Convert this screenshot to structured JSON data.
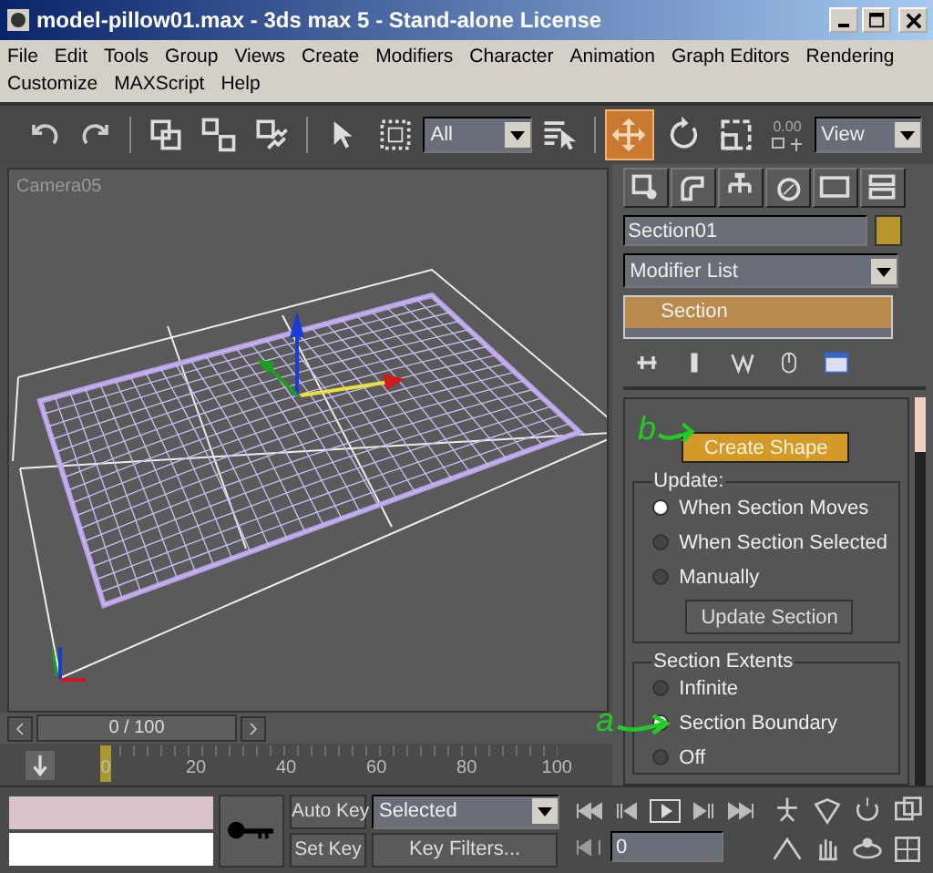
{
  "window": {
    "title": "model-pillow01.max - 3ds max 5 - Stand-alone License"
  },
  "menu_bar": {
    "items": [
      "File",
      "Edit",
      "Tools",
      "Group",
      "Views",
      "Create",
      "Modifiers",
      "Character",
      "Animation",
      "Graph Editors",
      "Rendering",
      "Customize",
      "MAXScript",
      "Help"
    ]
  },
  "toolbar": {
    "tools": [
      {
        "kind": "undo",
        "selected": false
      },
      {
        "kind": "redo",
        "selected": false
      },
      {
        "kind": "link",
        "selected": false
      },
      {
        "kind": "unlink",
        "selected": false
      },
      {
        "kind": "bind",
        "selected": false
      },
      {
        "kind": "select",
        "selected": false
      },
      {
        "kind": "region",
        "selected": false
      },
      {
        "kind": "filter",
        "value": "All"
      },
      {
        "kind": "select-by-name",
        "selected": false
      },
      {
        "kind": "move",
        "selected": true
      },
      {
        "kind": "rotate",
        "selected": false
      },
      {
        "kind": "scale",
        "selected": false
      },
      {
        "kind": "snap",
        "value": "0.00"
      },
      {
        "kind": "coord",
        "value": "View"
      }
    ]
  },
  "viewport": {
    "label": "Camera05"
  },
  "time_slider": {
    "value": "0 / 100"
  },
  "track_bar": {
    "ticks": [
      "0",
      "20",
      "40",
      "60",
      "80",
      "100"
    ]
  },
  "command_panel": {
    "object_name": "Section01",
    "modifier_list": "Modifier List",
    "stack": [
      {
        "label": "Section",
        "selected": true
      }
    ],
    "create_shape": "Create Shape",
    "update": {
      "title": "Update:",
      "options": [
        {
          "label": "When Section Moves",
          "selected": true
        },
        {
          "label": "When Section Selected",
          "selected": false
        },
        {
          "label": "Manually",
          "selected": false
        }
      ],
      "button": "Update Section"
    },
    "section_extents": {
      "title": "Section Extents",
      "options": [
        {
          "label": "Infinite",
          "selected": false
        },
        {
          "label": "Section Boundary",
          "selected": true
        },
        {
          "label": "Off",
          "selected": false
        }
      ]
    }
  },
  "annotations": [
    {
      "label": "b"
    },
    {
      "label": "a"
    }
  ],
  "bottom": {
    "auto_key": "Auto Key",
    "set_key": "Set Key",
    "key_mode": "Selected",
    "key_filters": "Key Filters...",
    "current_frame": "0"
  }
}
